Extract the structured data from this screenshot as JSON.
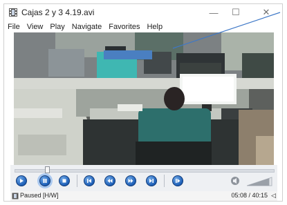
{
  "window": {
    "title": "Cajas 2 y 3 4.19.avi",
    "minimize_glyph": "—",
    "maximize_glyph": "☐",
    "close_glyph": "✕"
  },
  "menu": [
    "File",
    "View",
    "Play",
    "Navigate",
    "Favorites",
    "Help"
  ],
  "player": {
    "seek_position_fraction": 0.127,
    "volume_fraction": 0.9
  },
  "status": {
    "state": "Paused [H/W]",
    "time": "05:08 / 40:15",
    "speaker_glyph": "◁"
  },
  "colors": {
    "accent_blue": "#1d5fb7",
    "redaction_blue": "#4a7fc1",
    "annotation_line": "#3e78c7"
  },
  "icons": {
    "app": "film-icon",
    "controls": [
      "play-icon",
      "pause-icon",
      "stop-icon",
      "skip-back-icon",
      "rewind-icon",
      "fast-forward-icon",
      "skip-forward-icon",
      "frame-step-icon"
    ],
    "volume": "volume-icon"
  }
}
